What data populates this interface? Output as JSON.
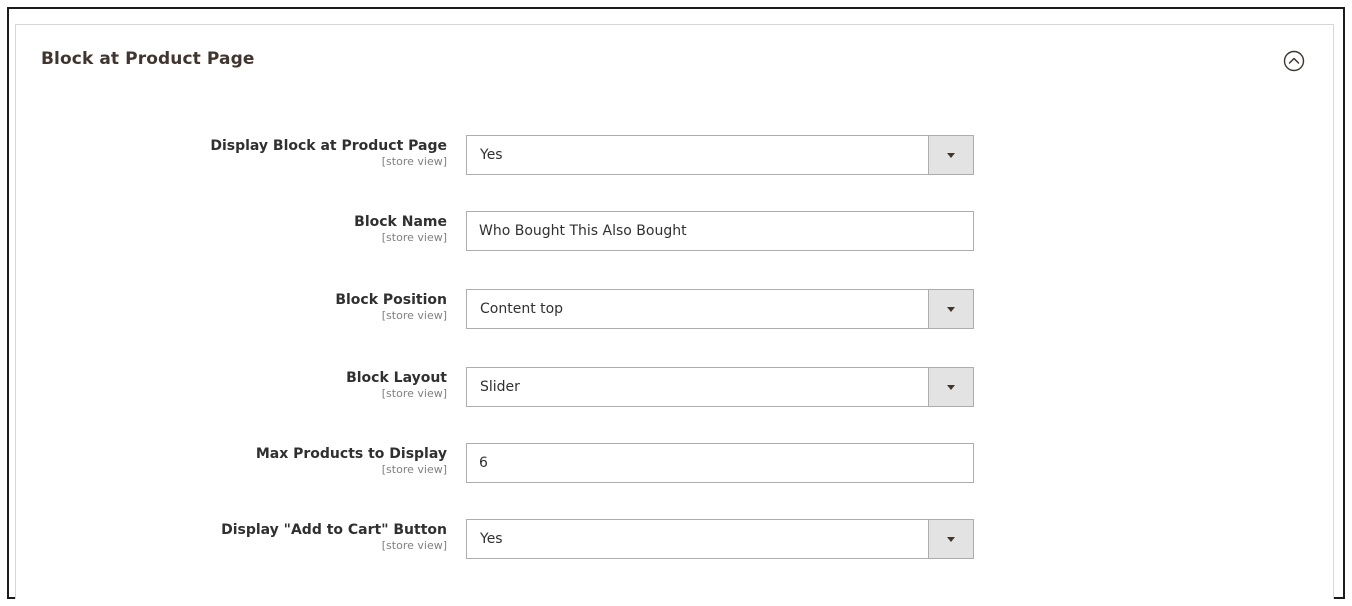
{
  "section": {
    "title": "Block at Product Page"
  },
  "fields": [
    {
      "label": "Display Block at Product Page",
      "scope": "[store view]",
      "type": "select",
      "value": "Yes"
    },
    {
      "label": "Block Name",
      "scope": "[store view]",
      "type": "text",
      "value": "Who Bought This Also Bought"
    },
    {
      "label": "Block Position",
      "scope": "[store view]",
      "type": "select",
      "value": "Content top"
    },
    {
      "label": "Block Layout",
      "scope": "[store view]",
      "type": "select",
      "value": "Slider"
    },
    {
      "label": "Max Products to Display",
      "scope": "[store view]",
      "type": "text",
      "value": "6"
    },
    {
      "label": "Display \"Add to Cart\" Button",
      "scope": "[store view]",
      "type": "select",
      "value": "Yes"
    }
  ],
  "icons": {
    "collapse": "chevron-up-circle-icon",
    "select_arrow": "triangle-down-icon"
  },
  "colors": {
    "select_arrow_bg": "#e3e3e3",
    "border": "#adadad",
    "title": "#41362f"
  }
}
